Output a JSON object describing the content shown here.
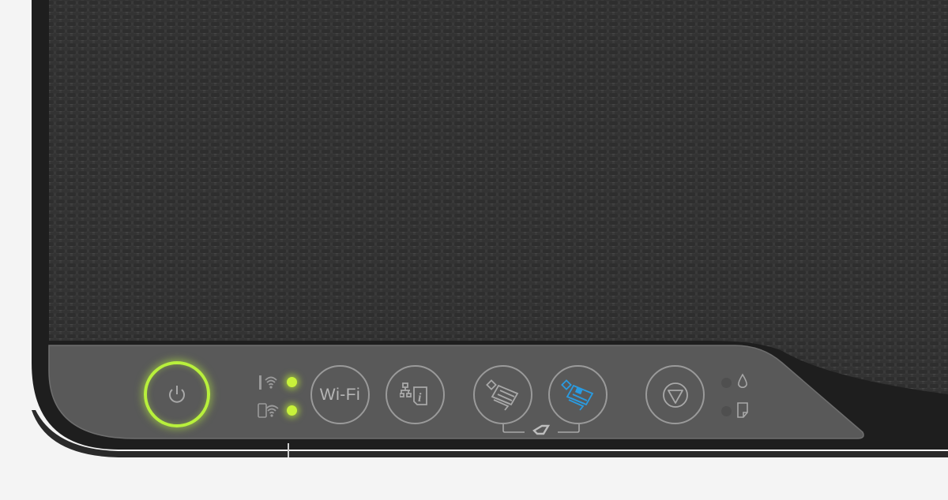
{
  "control_panel": {
    "wifi_button_label": "Wi-Fi",
    "power_ring_color": "#b8f03c",
    "led_color": "#c8f23a",
    "color_copy_accent": "#2a9be0",
    "icons": [
      "power-icon",
      "wifi-router-icon",
      "wifi-direct-icon",
      "network-status-icon",
      "bw-copy-icon",
      "color-copy-icon",
      "scanner-lid-icon",
      "stop-icon",
      "ink-drop-icon",
      "paper-icon"
    ]
  }
}
